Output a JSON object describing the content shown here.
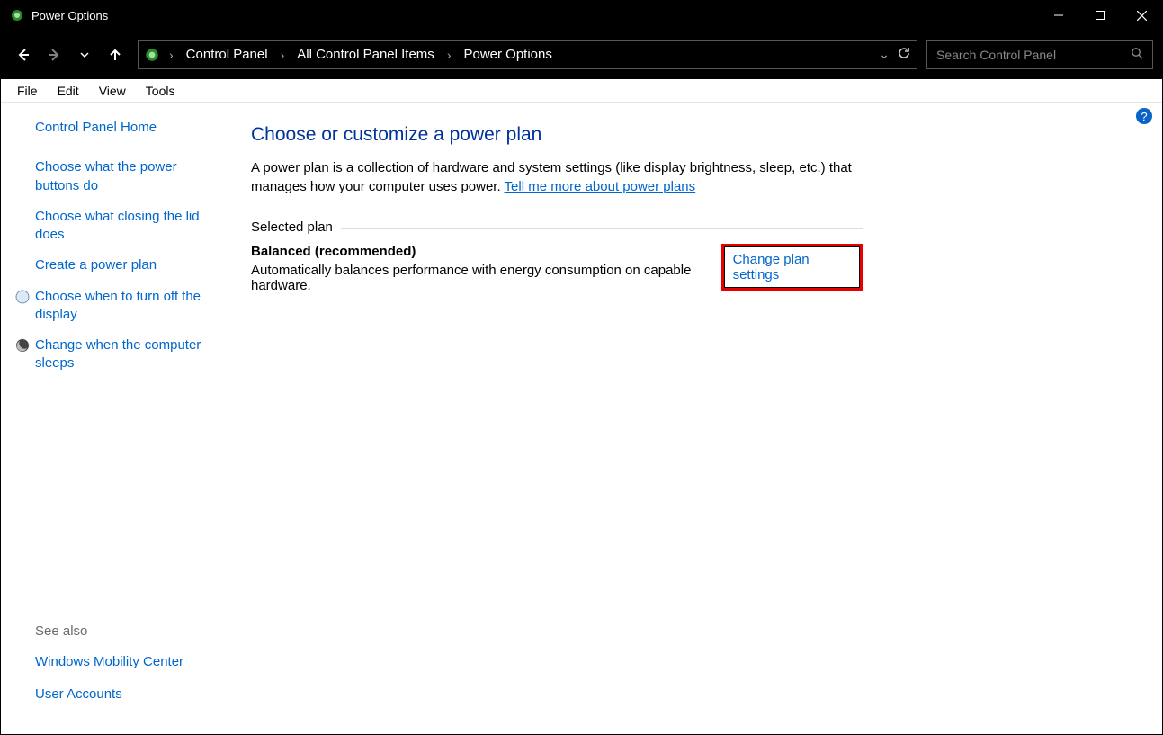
{
  "window": {
    "title": "Power Options"
  },
  "breadcrumb": {
    "items": [
      "Control Panel",
      "All Control Panel Items",
      "Power Options"
    ]
  },
  "search": {
    "placeholder": "Search Control Panel"
  },
  "menu": {
    "items": [
      "File",
      "Edit",
      "View",
      "Tools"
    ]
  },
  "sidebar": {
    "home": "Control Panel Home",
    "links": [
      "Choose what the power buttons do",
      "Choose what closing the lid does",
      "Create a power plan",
      "Choose when to turn off the display",
      "Change when the computer sleeps"
    ],
    "see_also_label": "See also",
    "see_also": [
      "Windows Mobility Center",
      "User Accounts"
    ]
  },
  "main": {
    "title": "Choose or customize a power plan",
    "description": "A power plan is a collection of hardware and system settings (like display brightness, sleep, etc.) that manages how your computer uses power. ",
    "learn_link": "Tell me more about power plans",
    "section_label": "Selected plan",
    "plan_name": "Balanced (recommended)",
    "plan_desc": "Automatically balances performance with energy consumption on capable hardware.",
    "change_link": "Change plan settings"
  },
  "help_icon_glyph": "?"
}
